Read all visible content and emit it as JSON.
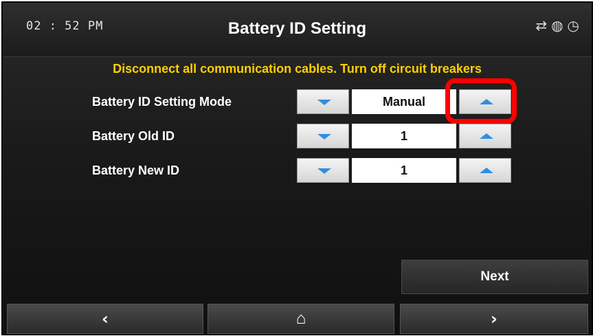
{
  "header": {
    "time": "02 : 52 PM",
    "title": "Battery ID Setting",
    "status_icons": [
      "sync-icon",
      "globe-icon",
      "gauge-icon"
    ]
  },
  "warning": "Disconnect all communication cables. Turn off circuit breakers",
  "settings": [
    {
      "label": "Battery ID Setting Mode",
      "value": "Manual"
    },
    {
      "label": "Battery Old ID",
      "value": "1"
    },
    {
      "label": "Battery New ID",
      "value": "1"
    }
  ],
  "next_label": "Next",
  "nav": {
    "prev": "‹",
    "home": "⌂",
    "next": "›"
  },
  "colors": {
    "warning_text": "#ffd000",
    "arrow": "#2f8fe0",
    "highlight": "#ff0000"
  }
}
